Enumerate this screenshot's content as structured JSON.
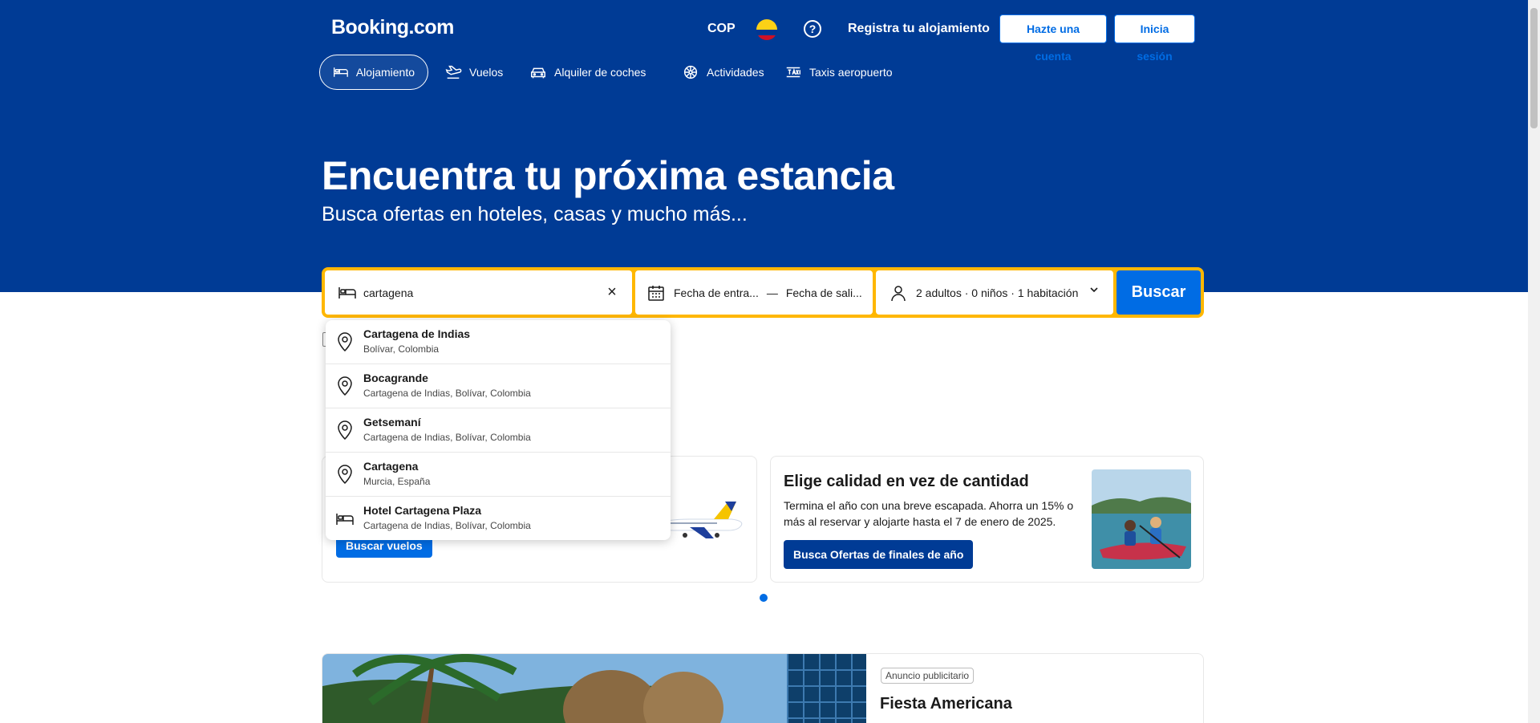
{
  "header": {
    "logo": "Booking.com",
    "currency": "COP",
    "help_symbol": "?",
    "register_label": "Registra tu alojamiento",
    "create_account_label": "Hazte una cuenta",
    "login_label": "Inicia sesión"
  },
  "nav": {
    "items": [
      {
        "label": "Alojamiento",
        "icon": "bed-icon",
        "active": true
      },
      {
        "label": "Vuelos",
        "icon": "plane-icon",
        "active": false
      },
      {
        "label": "Alquiler de coches",
        "icon": "car-icon",
        "active": false
      },
      {
        "label": "Actividades",
        "icon": "attractions-icon",
        "active": false
      },
      {
        "label": "Taxis aeropuerto",
        "icon": "taxi-icon",
        "active": false
      }
    ]
  },
  "hero": {
    "title": "Encuentra tu próxima estancia",
    "subtitle": "Busca ofertas en hoteles, casas y mucho más..."
  },
  "search": {
    "destination_value": "cartagena",
    "checkin_label": "Fecha de entra...",
    "date_separator": "—",
    "checkout_label": "Fecha de sali...",
    "guests_label": "2 adultos · 0 niños · 1 habitación",
    "search_button_label": "Buscar",
    "clear_symbol": "×"
  },
  "suggestions": [
    {
      "title": "Cartagena de Indias",
      "subtitle": "Bolívar, Colombia",
      "icon": "location-pin-icon"
    },
    {
      "title": "Bocagrande",
      "subtitle": "Cartagena de Indias, Bolívar, Colombia",
      "icon": "location-pin-icon"
    },
    {
      "title": "Getsemaní",
      "subtitle": "Cartagena de Indias, Bolívar, Colombia",
      "icon": "location-pin-icon"
    },
    {
      "title": "Cartagena",
      "subtitle": "Murcia, España",
      "icon": "location-pin-icon"
    },
    {
      "title": "Hotel Cartagena Plaza",
      "subtitle": "Cartagena de Indias, Bolívar, Colombia",
      "icon": "bed-icon"
    }
  ],
  "promo_flights": {
    "button_label": "Buscar vuelos"
  },
  "promo_quality": {
    "title": "Elige calidad en vez de cantidad",
    "description": "Termina el año con una breve escapada. Ahorra un 15% o más al reservar y alojarte hasta el 7 de enero de 2025.",
    "button_label": "Busca Ofertas de finales de año"
  },
  "ad": {
    "tag": "Anuncio publicitario",
    "title": "Fiesta Americana"
  },
  "colors": {
    "brand_blue": "#003b95",
    "action_blue": "#006ce4",
    "search_border": "#ffb700"
  }
}
